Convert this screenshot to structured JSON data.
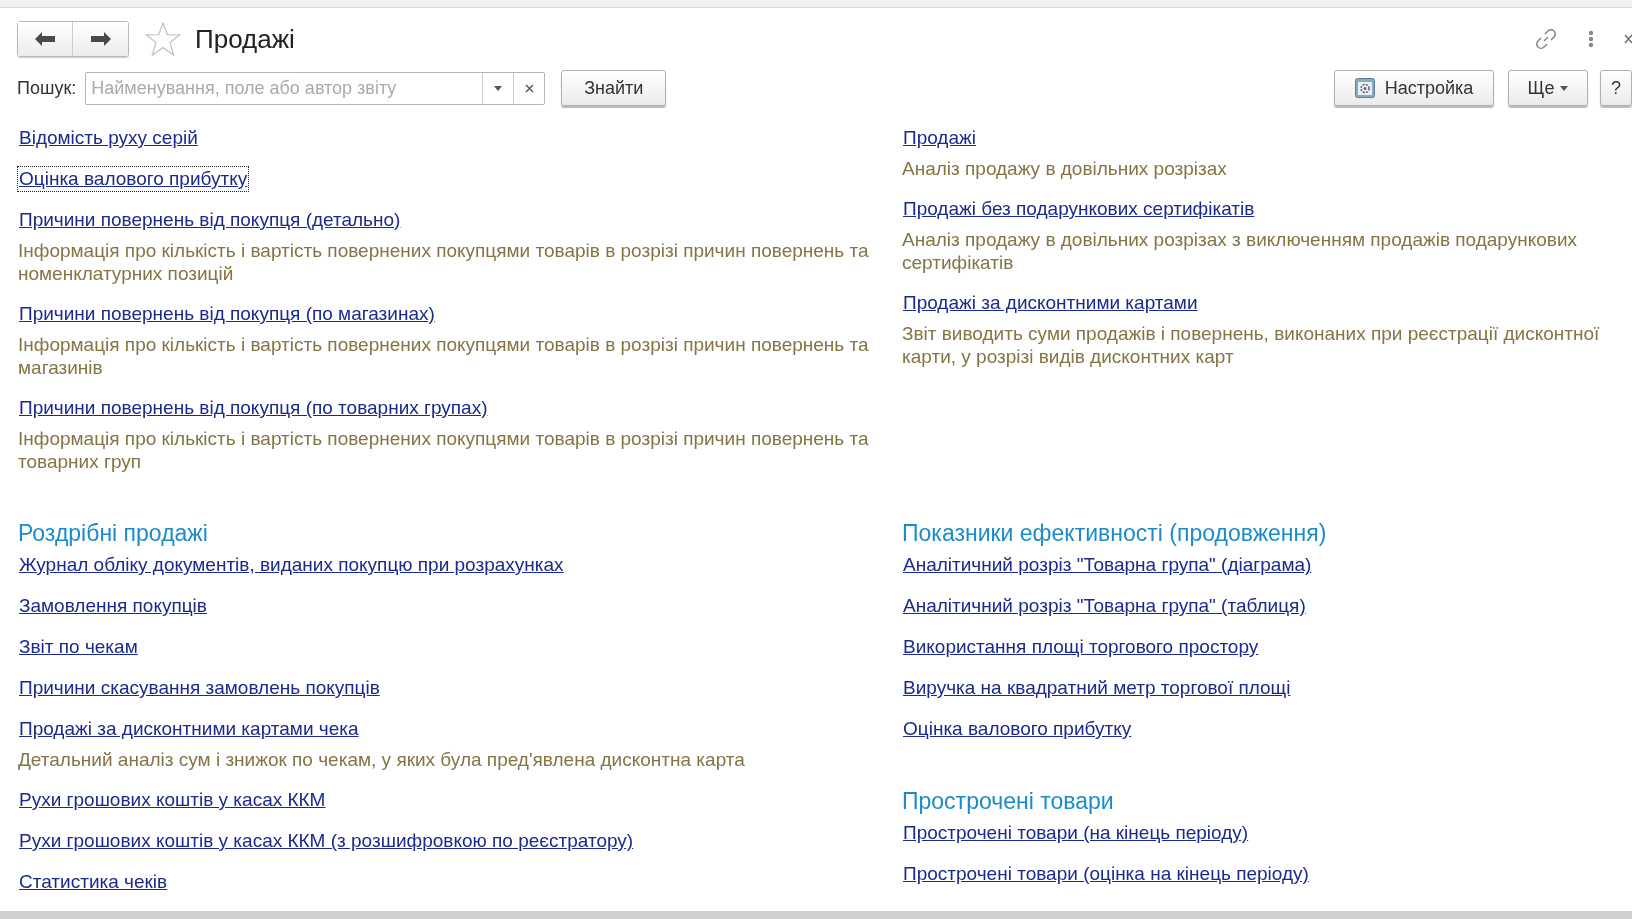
{
  "header": {
    "title": "Продажі",
    "search_label": "Пошук:",
    "search": {
      "placeholder": "Найменування, поле або автор звіту"
    },
    "find_button": "Знайти",
    "settings_button": "Настройка",
    "more_button": "Ще",
    "help_button": "?"
  },
  "rows": [
    {
      "columns": [
        [
          {
            "items": [
              {
                "title": "Відомість руху серій",
                "focused": false
              },
              {
                "title": "Оцінка валового прибутку",
                "focused": true
              },
              {
                "title": "Причини повернень від покупця (детально)",
                "description": "Інформація про кількість і вартість повернених покупцями товарів в розрізі причин повернень та номенклатурних позицій",
                "focused": false
              },
              {
                "title": "Причини повернень від покупця (по магазинах)",
                "description": "Інформація про кількість і вартість повернених покупцями товарів в розрізі причин повернень та магазинів",
                "focused": false
              },
              {
                "title": "Причини повернень від покупця (по товарних групах)",
                "description": "Інформація про кількість і вартість повернених покупцями товарів в розрізі причин повернень та товарних груп",
                "focused": false
              }
            ]
          }
        ],
        [
          {
            "items": [
              {
                "title": "Продажі",
                "description": "Аналіз продажу в довільних розрізах",
                "focused": false
              },
              {
                "title": "Продажі без подарункових сертифікатів",
                "description": "Аналіз продажу в довільних розрізах з виключенням продажів подарункових сертифікатів",
                "focused": false
              },
              {
                "title": "Продажі за дисконтними картами",
                "description": "Звіт виводить суми продажів і повернень, виконаних при реєстрації дисконтної карти, у розрізі видів дисконтних карт",
                "focused": false
              }
            ]
          }
        ]
      ]
    },
    {
      "columns": [
        [
          {
            "heading": "Роздрібні продажі",
            "items": [
              {
                "title": "Журнал обліку документів, виданих покупцю при розрахунках",
                "focused": false
              },
              {
                "title": "Замовлення покупців",
                "focused": false
              },
              {
                "title": "Звіт по чекам",
                "focused": false
              },
              {
                "title": "Причини скасування замовлень покупців",
                "focused": false
              },
              {
                "title": "Продажі за дисконтними картами чека",
                "description": "Детальний аналіз сум і знижок по чекам, у яких була пред'явлена дисконтна карта",
                "focused": false
              },
              {
                "title": "Рухи грошових коштів у касах ККМ",
                "focused": false
              },
              {
                "title": "Рухи грошових коштів у касах ККМ (з розшифровкою по реєстратору)",
                "focused": false
              },
              {
                "title": "Статистика чеків",
                "focused": false
              }
            ]
          }
        ],
        [
          {
            "heading": "Показники ефективності (продовження)",
            "items": [
              {
                "title": "Аналітичний розріз \"Товарна група\" (діаграма)",
                "focused": false
              },
              {
                "title": "Аналітичний розріз \"Товарна група\" (таблиця)",
                "focused": false
              },
              {
                "title": "Використання площі торгового простору",
                "focused": false
              },
              {
                "title": "Виручка на квадратний метр торгової площі",
                "focused": false
              },
              {
                "title": "Оцінка валового прибутку",
                "focused": false
              }
            ]
          },
          {
            "heading": "Прострочені товари",
            "items": [
              {
                "title": "Прострочені товари (на кінець періоду)",
                "focused": false
              },
              {
                "title": "Прострочені товари (оцінка на кінець періоду)",
                "focused": false
              }
            ]
          }
        ]
      ]
    }
  ]
}
